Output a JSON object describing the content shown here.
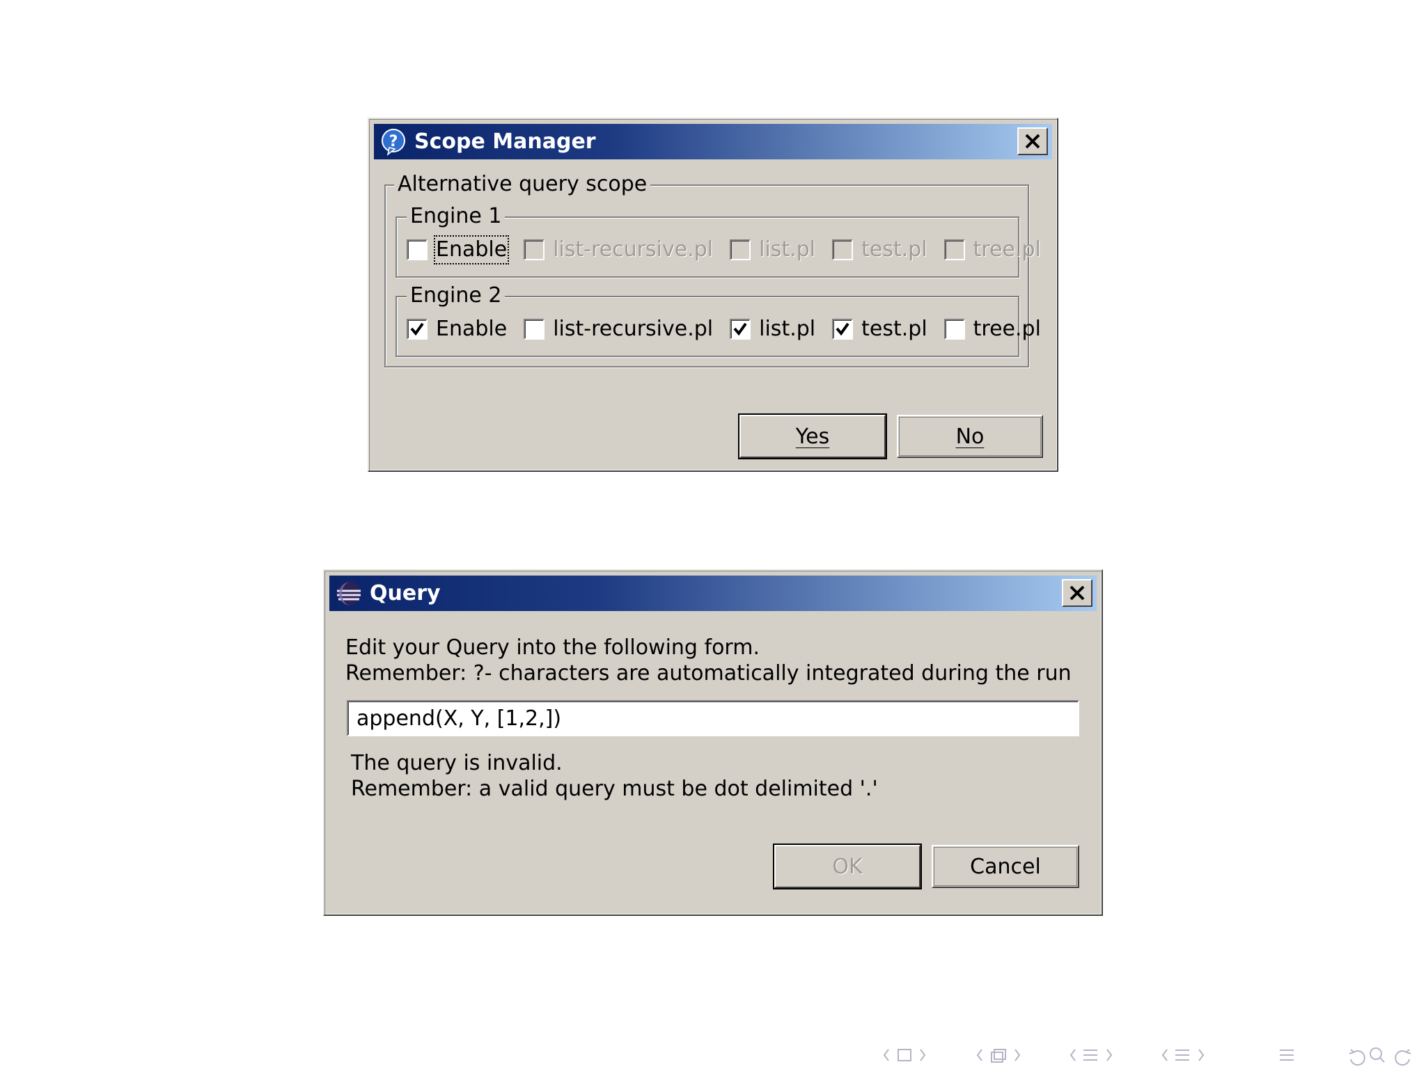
{
  "scope_dialog": {
    "title": "Scope Manager",
    "group_title": "Alternative query scope",
    "engines": [
      {
        "title": "Engine 1",
        "items": [
          {
            "label": "Enable",
            "checked": false,
            "disabled": false,
            "focused": true
          },
          {
            "label": "list-recursive.pl",
            "checked": false,
            "disabled": true
          },
          {
            "label": "list.pl",
            "checked": false,
            "disabled": true
          },
          {
            "label": "test.pl",
            "checked": false,
            "disabled": true
          },
          {
            "label": "tree.pl",
            "checked": false,
            "disabled": true
          }
        ]
      },
      {
        "title": "Engine 2",
        "items": [
          {
            "label": "Enable",
            "checked": true,
            "disabled": false
          },
          {
            "label": "list-recursive.pl",
            "checked": false,
            "disabled": false
          },
          {
            "label": "list.pl",
            "checked": true,
            "disabled": false
          },
          {
            "label": "test.pl",
            "checked": true,
            "disabled": false
          },
          {
            "label": "tree.pl",
            "checked": false,
            "disabled": false
          }
        ]
      }
    ],
    "yes_label": "Yes",
    "no_label": "No"
  },
  "query_dialog": {
    "title": "Query",
    "instruction_line1": "Edit your Query into the following form.",
    "instruction_line2": "Remember: ?- characters are automatically integrated during the run",
    "query_value": "append(X, Y, [1,2,])",
    "error_line1": "The query is invalid.",
    "error_line2": "Remember: a valid query must be dot delimited '.'",
    "ok_label": "OK",
    "cancel_label": "Cancel"
  },
  "colors": {
    "titlebar_start": "#0a246a",
    "titlebar_end": "#a6caf0",
    "dialog_face": "#d4d0c8"
  }
}
